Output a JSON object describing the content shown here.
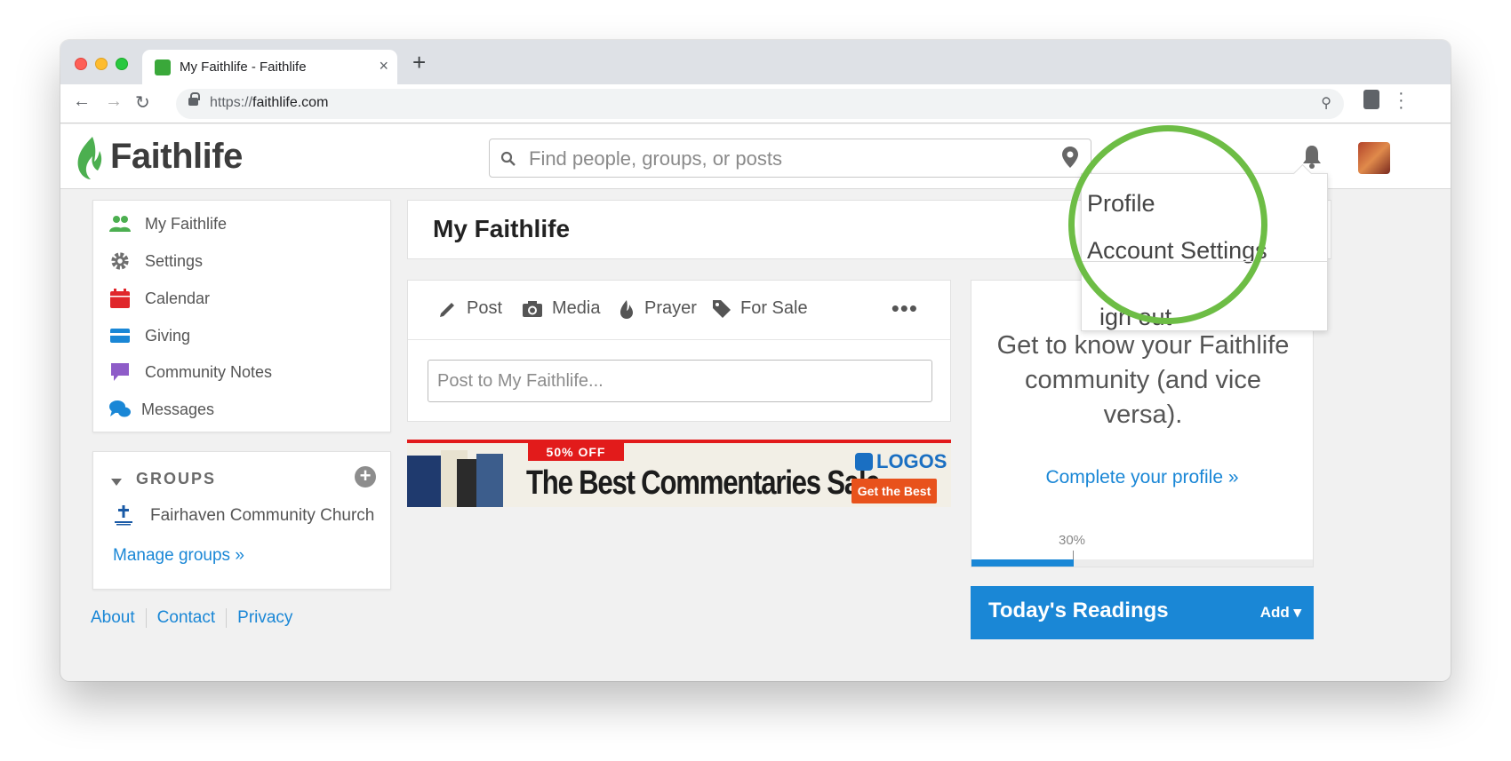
{
  "browser": {
    "tab_title": "My Faithlife - Faithlife",
    "tab_close": "×",
    "new_tab": "+",
    "url_scheme": "https://",
    "url_host": "faithlife.com"
  },
  "header": {
    "logo_text": "Faithlife",
    "search_placeholder": "Find people, groups, or posts"
  },
  "sidebar": {
    "items": [
      {
        "label": "My Faithlife",
        "icon": "people-icon",
        "color": "#4caf50"
      },
      {
        "label": "Settings",
        "icon": "gear-icon",
        "color": "#6f6f6f"
      },
      {
        "label": "Calendar",
        "icon": "calendar-icon",
        "color": "#e0262b"
      },
      {
        "label": "Giving",
        "icon": "credit-card-icon",
        "color": "#1a87d6"
      },
      {
        "label": "Community Notes",
        "icon": "note-icon",
        "color": "#8e5cc8"
      },
      {
        "label": "Messages",
        "icon": "chat-icon",
        "color": "#1a87d6"
      }
    ]
  },
  "groups": {
    "title": "GROUPS",
    "items": [
      {
        "label": "Fairhaven Community Church"
      }
    ],
    "manage_link": "Manage groups »"
  },
  "footer": {
    "links": [
      "About",
      "Contact",
      "Privacy"
    ]
  },
  "main": {
    "page_title": "My Faithlife",
    "composer_tabs": [
      "Post",
      "Media",
      "Prayer",
      "For Sale"
    ],
    "more": "•••",
    "post_placeholder": "Post to My Faithlife..."
  },
  "banner": {
    "badge": "50% OFF",
    "headline": "The Best Commentaries Sale",
    "brand": "LOGOS",
    "cta": "Get the Best"
  },
  "profile_card": {
    "copy": "Get to know your Faithlife community (and vice versa).",
    "link": "Complete your profile »",
    "progress_label": "30%",
    "progress": 0.3
  },
  "readings": {
    "title": "Today's Readings",
    "add": "Add ▾"
  },
  "account_menu": {
    "items": [
      "Profile",
      "Account Settings",
      "ign out"
    ]
  },
  "colors": {
    "accent": "#1a87d6",
    "brand_green": "#6dbd45",
    "promo_red": "#e21b1b"
  }
}
